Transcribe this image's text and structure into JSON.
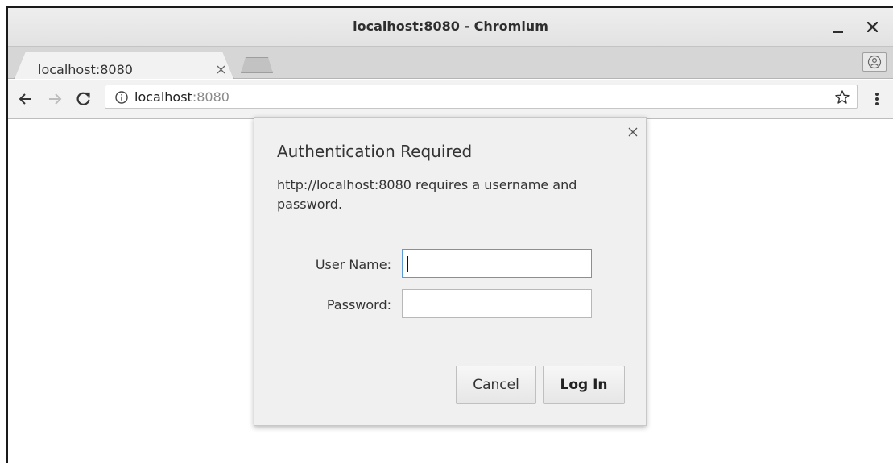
{
  "window": {
    "title": "localhost:8080 - Chromium"
  },
  "tab": {
    "title": "localhost:8080"
  },
  "toolbar": {
    "url_host": "localhost",
    "url_port": ":8080"
  },
  "dialog": {
    "title": "Authentication Required",
    "message": "http://localhost:8080 requires a username and password.",
    "username_label": "User Name:",
    "password_label": "Password:",
    "username_value": "",
    "password_value": "",
    "cancel_label": "Cancel",
    "login_label": "Log In"
  },
  "colors": {
    "focus_border": "#5b9bd5",
    "dialog_bg": "#f0f0f0"
  }
}
